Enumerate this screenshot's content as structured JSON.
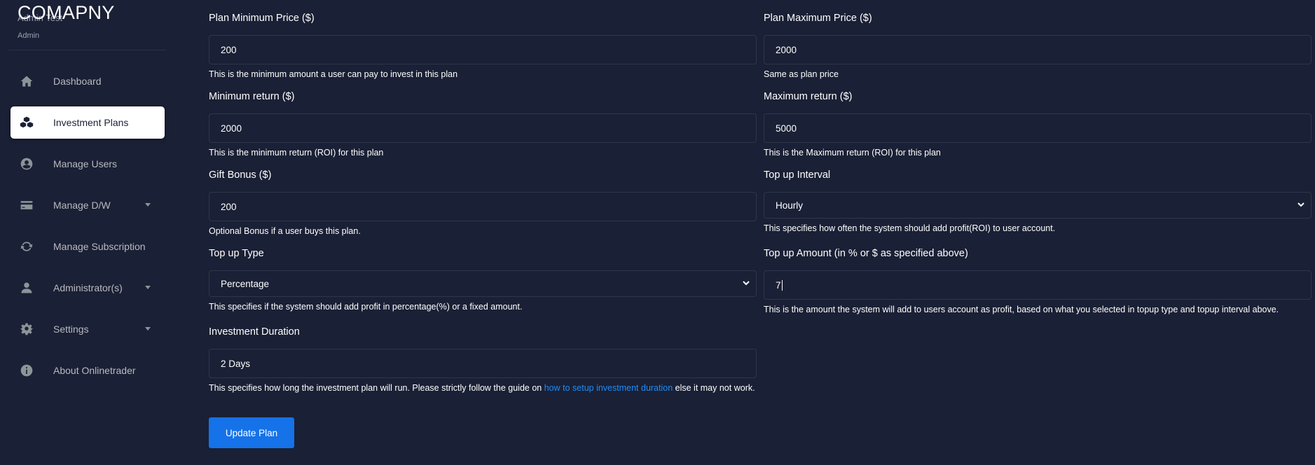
{
  "brand": {
    "name": "COMAPNY"
  },
  "user": {
    "name": "Admin Test",
    "role": "Admin"
  },
  "sidebar": {
    "items": [
      {
        "label": "Dashboard",
        "icon": "home-icon",
        "active": false
      },
      {
        "label": "Investment Plans",
        "icon": "cubes-icon",
        "active": true
      },
      {
        "label": "Manage Users",
        "icon": "user-circle-icon",
        "active": false
      },
      {
        "label": "Manage D/W",
        "icon": "credit-card-icon",
        "active": false,
        "has_submenu": true
      },
      {
        "label": "Manage Subscription",
        "icon": "refresh-icon",
        "active": false
      },
      {
        "label": "Administrator(s)",
        "icon": "user-icon",
        "active": false,
        "has_submenu": true
      },
      {
        "label": "Settings",
        "icon": "gear-icon",
        "active": false,
        "has_submenu": true
      },
      {
        "label": "About Onlinetrader",
        "icon": "info-icon",
        "active": false
      }
    ]
  },
  "form": {
    "min_price": {
      "label": "Plan Minimum Price ($)",
      "value": "200",
      "help": "This is the minimum amount a user can pay to invest in this plan"
    },
    "max_price": {
      "label": "Plan Maximum Price ($)",
      "value": "2000",
      "help": "Same as plan price"
    },
    "min_return": {
      "label": "Minimum return ($)",
      "value": "2000",
      "help": "This is the minimum return (ROI) for this plan"
    },
    "max_return": {
      "label": "Maximum return ($)",
      "value": "5000",
      "help": "This is the Maximum return (ROI) for this plan"
    },
    "gift_bonus": {
      "label": "Gift Bonus ($)",
      "value": "200",
      "help": "Optional Bonus if a user buys this plan."
    },
    "topup_interval": {
      "label": "Top up Interval",
      "value": "Hourly",
      "help": "This specifies how often the system should add profit(ROI) to user account."
    },
    "topup_type": {
      "label": "Top up Type",
      "value": "Percentage",
      "help": "This specifies if the system should add profit in percentage(%) or a fixed amount."
    },
    "topup_amount": {
      "label": "Top up Amount (in % or $ as specified above)",
      "value": "7",
      "help": "This is the amount the system will add to users account as profit, based on what you selected in topup type and topup interval above."
    },
    "duration": {
      "label": "Investment Duration",
      "value": "2 Days",
      "help_before": "This specifies how long the investment plan will run. Please strictly follow the guide on ",
      "help_link": "how to setup investment duration",
      "help_after": " else it may not work."
    },
    "submit_label": "Update Plan"
  },
  "colors": {
    "background": "#1a2035",
    "accent": "#1572e8",
    "link": "#1e8cf9"
  }
}
